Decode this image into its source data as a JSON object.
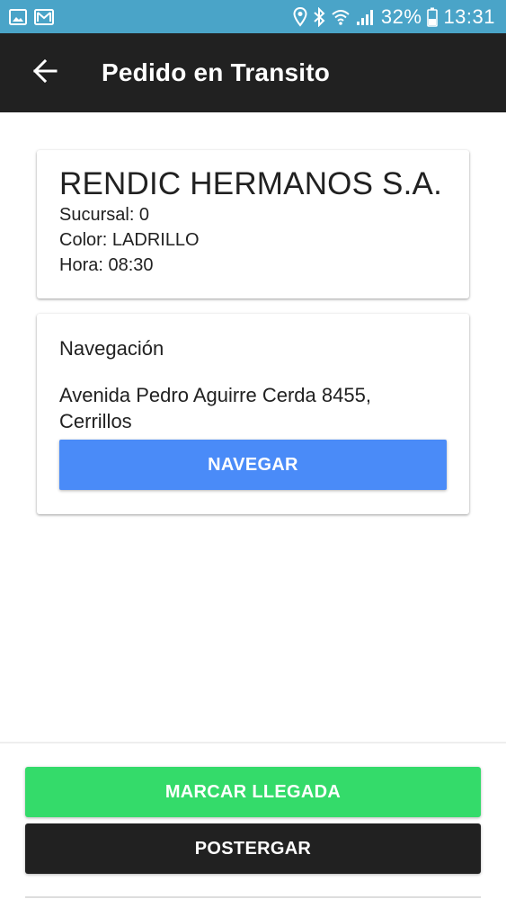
{
  "status_bar": {
    "battery": "32%",
    "time": "13:31",
    "icons": [
      "image-icon",
      "gmail-icon",
      "location-icon",
      "bluetooth-icon",
      "wifi-icon",
      "signal-icon",
      "battery-icon"
    ]
  },
  "app_bar": {
    "title": "Pedido en Transito",
    "back_icon": "arrow-left-icon"
  },
  "company_card": {
    "name": "RENDIC HERMANOS S.A.",
    "sucursal": "Sucursal: 0",
    "color": "Color: LADRILLO",
    "hora": "Hora: 08:30"
  },
  "navigation_card": {
    "title": "Navegación",
    "address": "Avenida Pedro Aguirre Cerda 8455, Cerrillos",
    "button_label": "NAVEGAR"
  },
  "actions": {
    "arrival_label": "MARCAR LLEGADA",
    "postpone_label": "POSTERGAR"
  },
  "colors": {
    "status_bar": "#4aa4c8",
    "app_bar": "#212121",
    "navigate_button": "#4a8bf8",
    "arrival_button": "#34db6a",
    "postpone_button": "#212121"
  }
}
